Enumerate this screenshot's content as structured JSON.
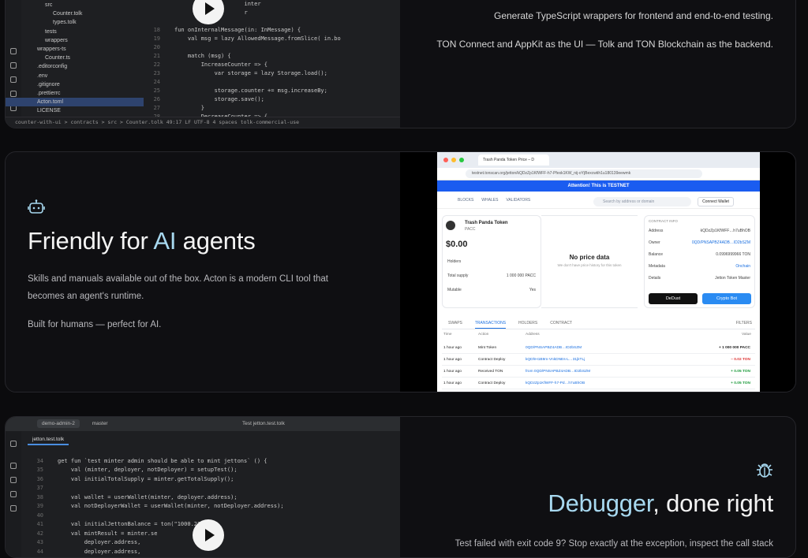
{
  "card1": {
    "tree": [
      "src",
      "Counter.tolk",
      "types.tolk",
      "tests",
      "wrappers",
      "wrappers-ts",
      "Counter.ts",
      ".editorconfig",
      ".env",
      ".gitignore",
      ".prettierrc",
      "Acton.toml",
      "LICENSE"
    ],
    "code": [
      {
        "ln": "",
        "tx": "                     inter"
      },
      {
        "ln": "",
        "tx": "                     r"
      },
      {
        "ln": "",
        "tx": ""
      },
      {
        "ln": "18",
        "tx": "fun onInternalMessage(in: InMessage) {"
      },
      {
        "ln": "19",
        "tx": "    val msg = lazy AllowedMessage.fromSlice( in.bo"
      },
      {
        "ln": "20",
        "tx": ""
      },
      {
        "ln": "21",
        "tx": "    match (msg) {"
      },
      {
        "ln": "22",
        "tx": "        IncreaseCounter => {"
      },
      {
        "ln": "23",
        "tx": "            var storage = lazy Storage.load();"
      },
      {
        "ln": "24",
        "tx": ""
      },
      {
        "ln": "25",
        "tx": "            storage.counter += msg.increaseBy;"
      },
      {
        "ln": "26",
        "tx": "            storage.save();"
      },
      {
        "ln": "27",
        "tx": "        }"
      },
      {
        "ln": "28",
        "tx": "        DecreaseCounter => {"
      }
    ],
    "status": "counter-with-ui > contracts > src > Counter.tolk        49:17   LF   UTF-8   4 spaces   tolk-commercial-use",
    "text1": "Generate TypeScript wrappers for frontend and end-to-end testing.",
    "text2": "TON Connect and AppKit as the UI — Tolk and TON Blockchain as the backend."
  },
  "card2": {
    "title_a": "Friendly for ",
    "title_hl": "AI",
    "title_b": " agents",
    "para1a": "Skills and manuals available out of the box. Acton is a modern CLI tool that",
    "para1b": "becomes an agent's runtime.",
    "para2": "Built for humans — perfect for AI.",
    "browser": {
      "tab": "Trash Panda Token Price – D",
      "url": "testnet.tonscan.org/jetton/kQDzZp1KfWFF-h7-Pfexk1KW_nij-oYjBexcwtih1u180139eewmk",
      "banner": "Attention! This is TESTNET",
      "nav": [
        "BLOCKS",
        "WHALES",
        "VALIDATORS"
      ],
      "search": "Search by address or domain",
      "connect": "Connect Wallet",
      "token_name": "Trash Panda Token",
      "token_sym": "PACC",
      "price": "$0.00",
      "holders_label": "Holders",
      "supply_label": "Total supply",
      "supply_val": "1 000 000 PACC",
      "mutable_label": "Mutable",
      "mutable_val": "Yes",
      "no_price": "No price data",
      "no_price_sub": "We don't have price history for this token",
      "contract_info": "CONTRACT INFO",
      "info_rows": [
        {
          "k": "Address",
          "v": "kQDzZp1KfWFF…h7uBhOB"
        },
        {
          "k": "Owner",
          "v": "0QD/PNSAPBZ4ADB…ID2bSZM"
        },
        {
          "k": "Balance",
          "v": "0.0996999966 TON"
        },
        {
          "k": "Metadata",
          "v": "Onchain"
        },
        {
          "k": "Details",
          "v": "Jetton   Token Master"
        }
      ],
      "dedust": "DeDust",
      "cryptobot": "Crypto Bot",
      "tabs": [
        "SWAPS",
        "TRANSACTIONS",
        "HOLDERS",
        "CONTRACT"
      ],
      "filters": "FILTERS",
      "cols": [
        "Time",
        "Action",
        "Address",
        "Value"
      ],
      "tx": [
        {
          "t": "1 hour ago",
          "a": "Mint Token",
          "ad": "0QD/PNSAPBZ4ADB…ID2bSZM",
          "v": "+ 1 000 000 PACC",
          "c": "#222"
        },
        {
          "t": "1 hour ago",
          "a": "Contract Deploy",
          "ad": "kQDhH1B9m-VnkDNEs-L…31jkTLj",
          "v": "– 0.02 TON",
          "c": "#d33"
        },
        {
          "t": "1 hour ago",
          "a": "Received TON",
          "ad": "from 0QD/PNSAPBZ4ADB…ID2bSZM",
          "v": "+ 0.05 TON",
          "c": "#1a9a3a"
        },
        {
          "t": "1 hour ago",
          "a": "Contract Deploy",
          "ad": "kQDzZp1KfWFF-h7-Pd…h7uBhOB",
          "v": "+ 0.05 TON",
          "c": "#1a9a3a"
        }
      ]
    }
  },
  "card3": {
    "filetab": "jetton.test.tolk",
    "branch": "master",
    "project": "demo-admin-2",
    "runconf": "Test jetton.test.tolk",
    "code": [
      {
        "ln": "",
        "tx": ""
      },
      {
        "ln": "34",
        "tx": "get fun `test minter admin should be able to mint jettons` () {"
      },
      {
        "ln": "35",
        "tx": "    val (minter, deployer, notDeployer) = setupTest();"
      },
      {
        "ln": "36",
        "tx": "    val initialTotalSupply = minter.getTotalSupply();"
      },
      {
        "ln": "37",
        "tx": ""
      },
      {
        "ln": "38",
        "tx": "    val wallet = userWallet(minter, deployer.address);"
      },
      {
        "ln": "39",
        "tx": "    val notDeployerWallet = userWallet(minter, notDeployer.address);"
      },
      {
        "ln": "40",
        "tx": ""
      },
      {
        "ln": "41",
        "tx": "    val initialJettonBalance = ton(\"1000.23\");"
      },
      {
        "ln": "42",
        "tx": "    val mintResult = minter.se"
      },
      {
        "ln": "43",
        "tx": "        deployer.address,"
      },
      {
        "ln": "44",
        "tx": "        deployer.address,"
      }
    ],
    "title_hl": "Debugger",
    "title_b": ", done right",
    "para": "Test failed with exit code 9? Stop exactly at the exception, inspect the call stack"
  },
  "colors": {
    "accent": "#a7d8ef",
    "bg": "#0b0b0d",
    "card": "#0f0f12"
  }
}
